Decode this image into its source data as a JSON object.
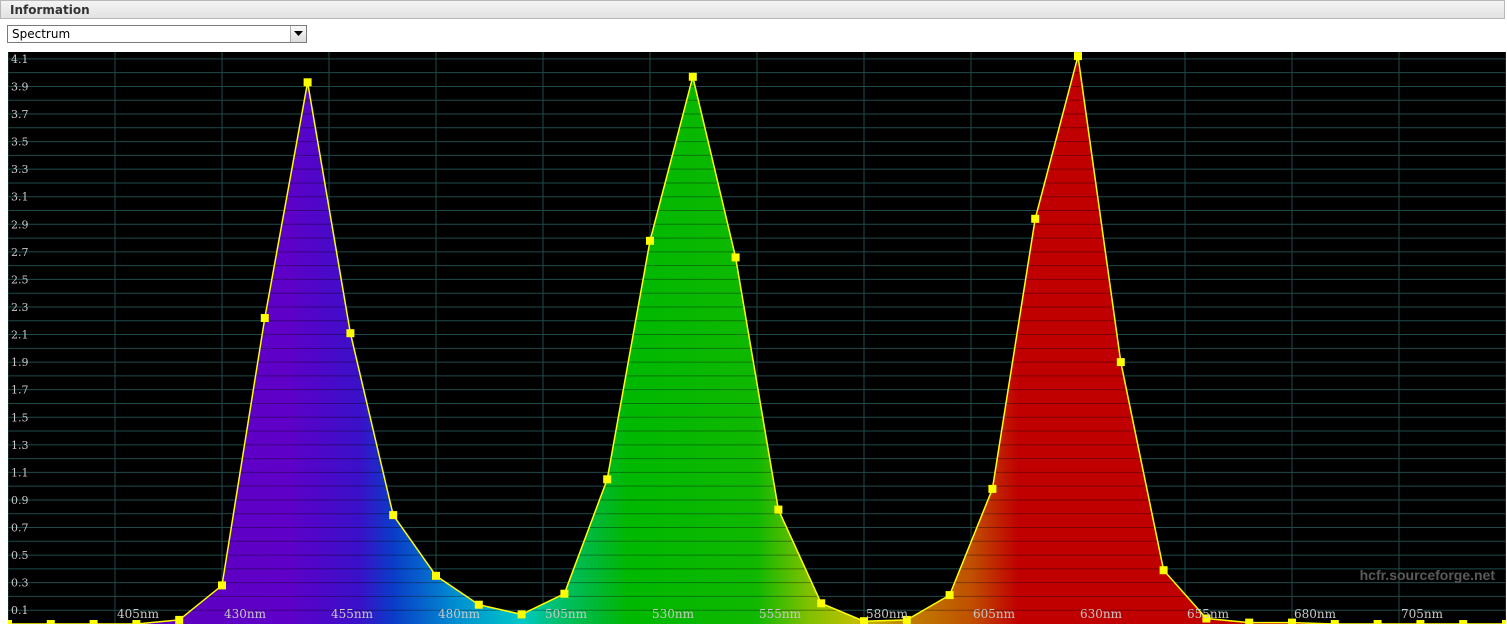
{
  "panel": {
    "title": "Information"
  },
  "view_select": {
    "value": "Spectrum"
  },
  "watermark": "hcfr.sourceforge.net",
  "chart_data": {
    "type": "area",
    "title": "",
    "xlabel": "",
    "ylabel": "",
    "xlim": [
      380,
      730
    ],
    "ylim": [
      0,
      4.15
    ],
    "grid": true,
    "x_tick_labels": [
      "405nm",
      "430nm",
      "455nm",
      "480nm",
      "505nm",
      "530nm",
      "555nm",
      "580nm",
      "605nm",
      "630nm",
      "655nm",
      "680nm",
      "705nm"
    ],
    "x_ticks": [
      405,
      430,
      455,
      480,
      505,
      530,
      555,
      580,
      605,
      630,
      655,
      680,
      705
    ],
    "y_tick_labels": [
      "0.1",
      "0.3",
      "0.5",
      "0.7",
      "0.9",
      "1.1",
      "1.3",
      "1.5",
      "1.7",
      "1.9",
      "2.1",
      "2.3",
      "2.5",
      "2.7",
      "2.9",
      "3.1",
      "3.3",
      "3.5",
      "3.7",
      "3.9",
      "4.1"
    ],
    "series": [
      {
        "x": [
          380,
          390,
          400,
          410,
          420,
          430,
          440,
          450,
          460,
          470,
          480,
          490,
          500,
          510,
          520,
          530,
          540,
          550,
          560,
          570,
          580,
          590,
          600,
          610,
          620,
          630,
          640,
          650,
          660,
          670,
          680,
          690,
          700,
          710,
          720,
          730
        ],
        "y": [
          0.0,
          0.0,
          0.0,
          0.0,
          0.03,
          0.28,
          2.22,
          3.93,
          2.11,
          0.79,
          0.35,
          0.14,
          0.07,
          0.22,
          1.05,
          2.78,
          3.97,
          2.66,
          0.83,
          0.15,
          0.02,
          0.03,
          0.21,
          0.98,
          2.94,
          4.12,
          1.9,
          0.39,
          0.04,
          0.01,
          0.01,
          0.0,
          0.0,
          0.0,
          0.0,
          0.0
        ]
      }
    ],
    "colors": {
      "background": "#000000",
      "grid": "#1f4a4a",
      "line": "#ffff00",
      "marker": "#ffff00",
      "label": "#c8c8c8"
    }
  }
}
